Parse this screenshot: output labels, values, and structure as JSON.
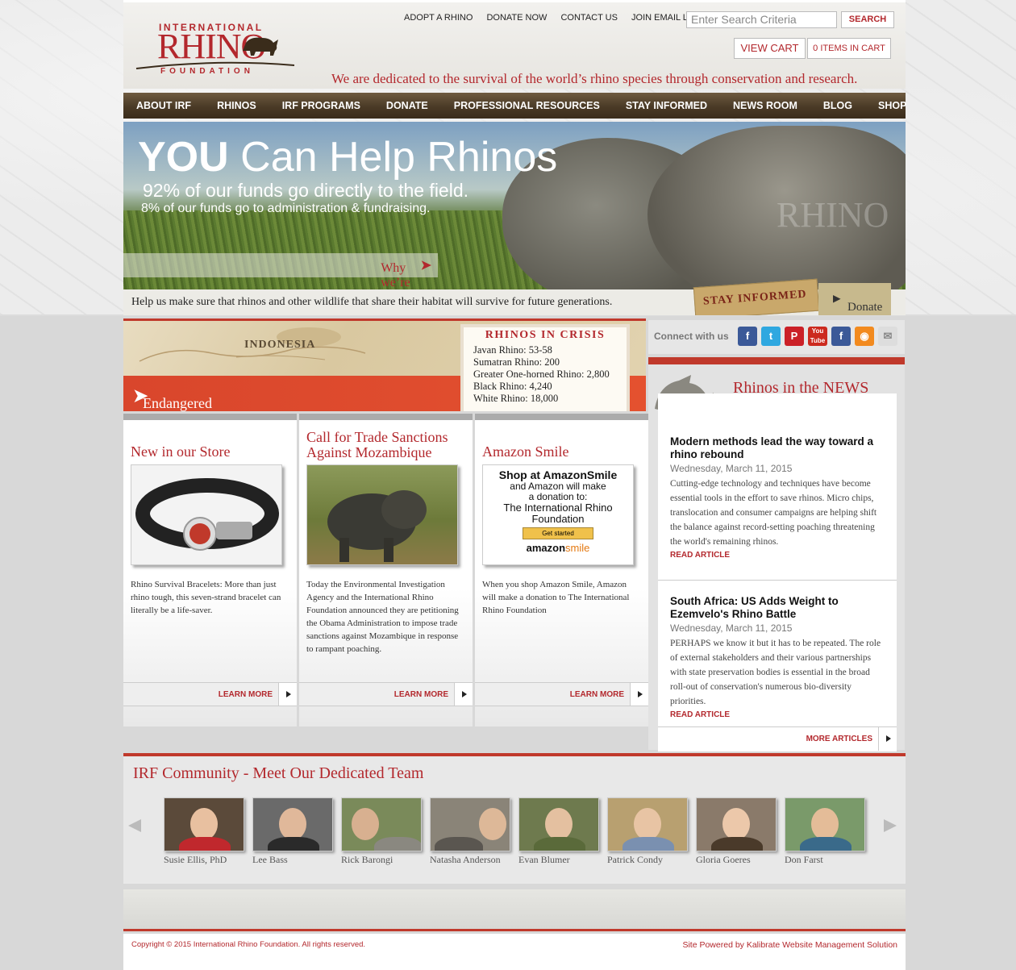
{
  "header": {
    "logo": {
      "line1": "INTERNATIONAL",
      "line2": "RHINO",
      "line3": "FOUNDATION"
    },
    "top_links": [
      "ADOPT A RHINO",
      "DONATE NOW",
      "CONTACT US",
      "JOIN EMAIL LIST"
    ],
    "search": {
      "placeholder": "Enter Search Criteria",
      "button": "SEARCH"
    },
    "cart": {
      "view_label": "VIEW CART",
      "count_label": "0 ITEMS IN CART"
    },
    "tagline": "We are dedicated to the survival of the world’s rhino species through conservation and research."
  },
  "nav": [
    "ABOUT IRF",
    "RHINOS",
    "IRF PROGRAMS",
    "DONATE",
    "PROFESSIONAL RESOURCES",
    "STAY INFORMED",
    "NEWS ROOM",
    "BLOG",
    "SHOP"
  ],
  "hero": {
    "title_bold": "YOU",
    "title_rest": " Can Help Rhinos",
    "line2": "92% of our funds go directly to the field.",
    "line3": "8% of our funds go to administration & fundraising.",
    "why": "Why we’re different",
    "footer_text": "Help us make sure that rhinos and other wildlife that share their habitat will survive for future generations.",
    "stay_informed": "STAY INFORMED",
    "donate": "Donate",
    "watermark": "RHINO"
  },
  "map_banner": {
    "map_label": "INDONESIA",
    "link": "Endangered Rhinos: See the population map",
    "crisis": {
      "title": "RHINOS IN CRISIS",
      "rows": [
        "Javan Rhino: 53-58",
        "Sumatran Rhino: 200",
        "Greater One-horned Rhino: 2,800",
        "Black Rhino: 4,240",
        "White Rhino: 18,000"
      ]
    }
  },
  "columns": [
    {
      "heading": "New in our Store",
      "desc": "Rhino Survival Bracelets: More than just rhino tough, this seven-strand bracelet can literally be a life-saver.",
      "more": "LEARN MORE"
    },
    {
      "heading": "Call for Trade Sanctions Against Mozambique",
      "desc": "Today the Environmental Investigation Agency and the International Rhino Foundation announced they are petitioning the Obama Administration to impose trade sanctions against Mozambique in response to rampant poaching.",
      "more": "LEARN MORE"
    },
    {
      "heading": "Amazon Smile",
      "desc": "When you shop Amazon Smile, Amazon will make a donation to The International Rhino Foundation",
      "more": "LEARN MORE",
      "ad": {
        "l1": "Shop at AmazonSmile",
        "l2": "and Amazon will make",
        "l3": "a donation to:",
        "l4": "The International Rhino",
        "l5": "Foundation",
        "btn": "Get started",
        "brand1": "amazon",
        "brand2": "smile"
      }
    }
  ],
  "connect": {
    "label": "Connect with us"
  },
  "news": {
    "title": "Rhinos in the NEWS",
    "articles": [
      {
        "title": "Modern methods lead the way toward a rhino rebound",
        "date": "Wednesday, March 11, 2015",
        "body": "Cutting-edge technology and techniques have become essential tools in the effort to save rhinos. Micro chips, translocation and consumer campaigns are helping shift the balance against record-setting poaching threatening the world's remaining rhinos.",
        "read": "READ ARTICLE"
      },
      {
        "title": "South Africa: US Adds Weight to Ezemvelo's Rhino Battle",
        "date": "Wednesday, March 11, 2015",
        "body": "PERHAPS we know it but it has to be repeated. The role of external stakeholders and their various partnerships with state preservation bodies is essential in the broad roll-out of conservation's numerous bio-diversity priorities.",
        "read": "READ ARTICLE"
      }
    ],
    "more": "MORE ARTICLES"
  },
  "community": {
    "title": "IRF Community - Meet Our Dedicated Team",
    "people": [
      "Susie Ellis, PhD",
      "Lee Bass",
      "Rick Barongi",
      "Natasha Anderson",
      "Evan Blumer",
      "Patrick Condy",
      "Gloria Goeres",
      "Don Farst"
    ]
  },
  "footer": {
    "copyright": "Copyright © 2015 International Rhino Foundation. All rights reserved.",
    "powered": "Site Powered by Kalibrate Website Management Solution"
  },
  "colors": {
    "brand_red": "#b3282d",
    "nav_brown": "#4a3a26"
  }
}
